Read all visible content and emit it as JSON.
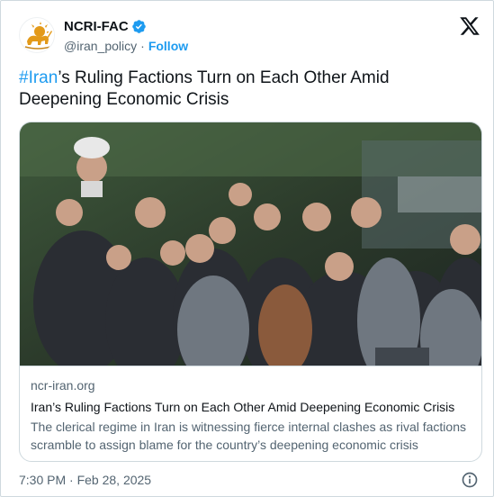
{
  "account": {
    "display_name": "NCRI-FAC",
    "handle": "@iran_policy",
    "separator": "·",
    "follow_label": "Follow"
  },
  "tweet": {
    "hashtag": "#Iran",
    "text_rest": "’s Ruling Factions Turn on Each Other Amid Deepening Economic Crisis"
  },
  "link_card": {
    "domain": "ncr-iran.org",
    "title": "Iran’s Ruling Factions Turn on Each Other Amid Deepening Economic Crisis",
    "description": "The clerical regime in Iran is witnessing fierce internal clashes as rival factions scramble to assign blame for the country’s deepening economic crisis"
  },
  "footer": {
    "timestamp": "7:30 PM · Feb 28, 2025"
  },
  "colors": {
    "accent": "#1d9bf0",
    "text_primary": "#0f1419",
    "text_secondary": "#536471",
    "border": "#cfd9de"
  },
  "icons": {
    "avatar": "lion-and-sun-logo",
    "verified": "verified-badge-icon",
    "brand": "x-logo-icon",
    "info": "info-icon"
  }
}
